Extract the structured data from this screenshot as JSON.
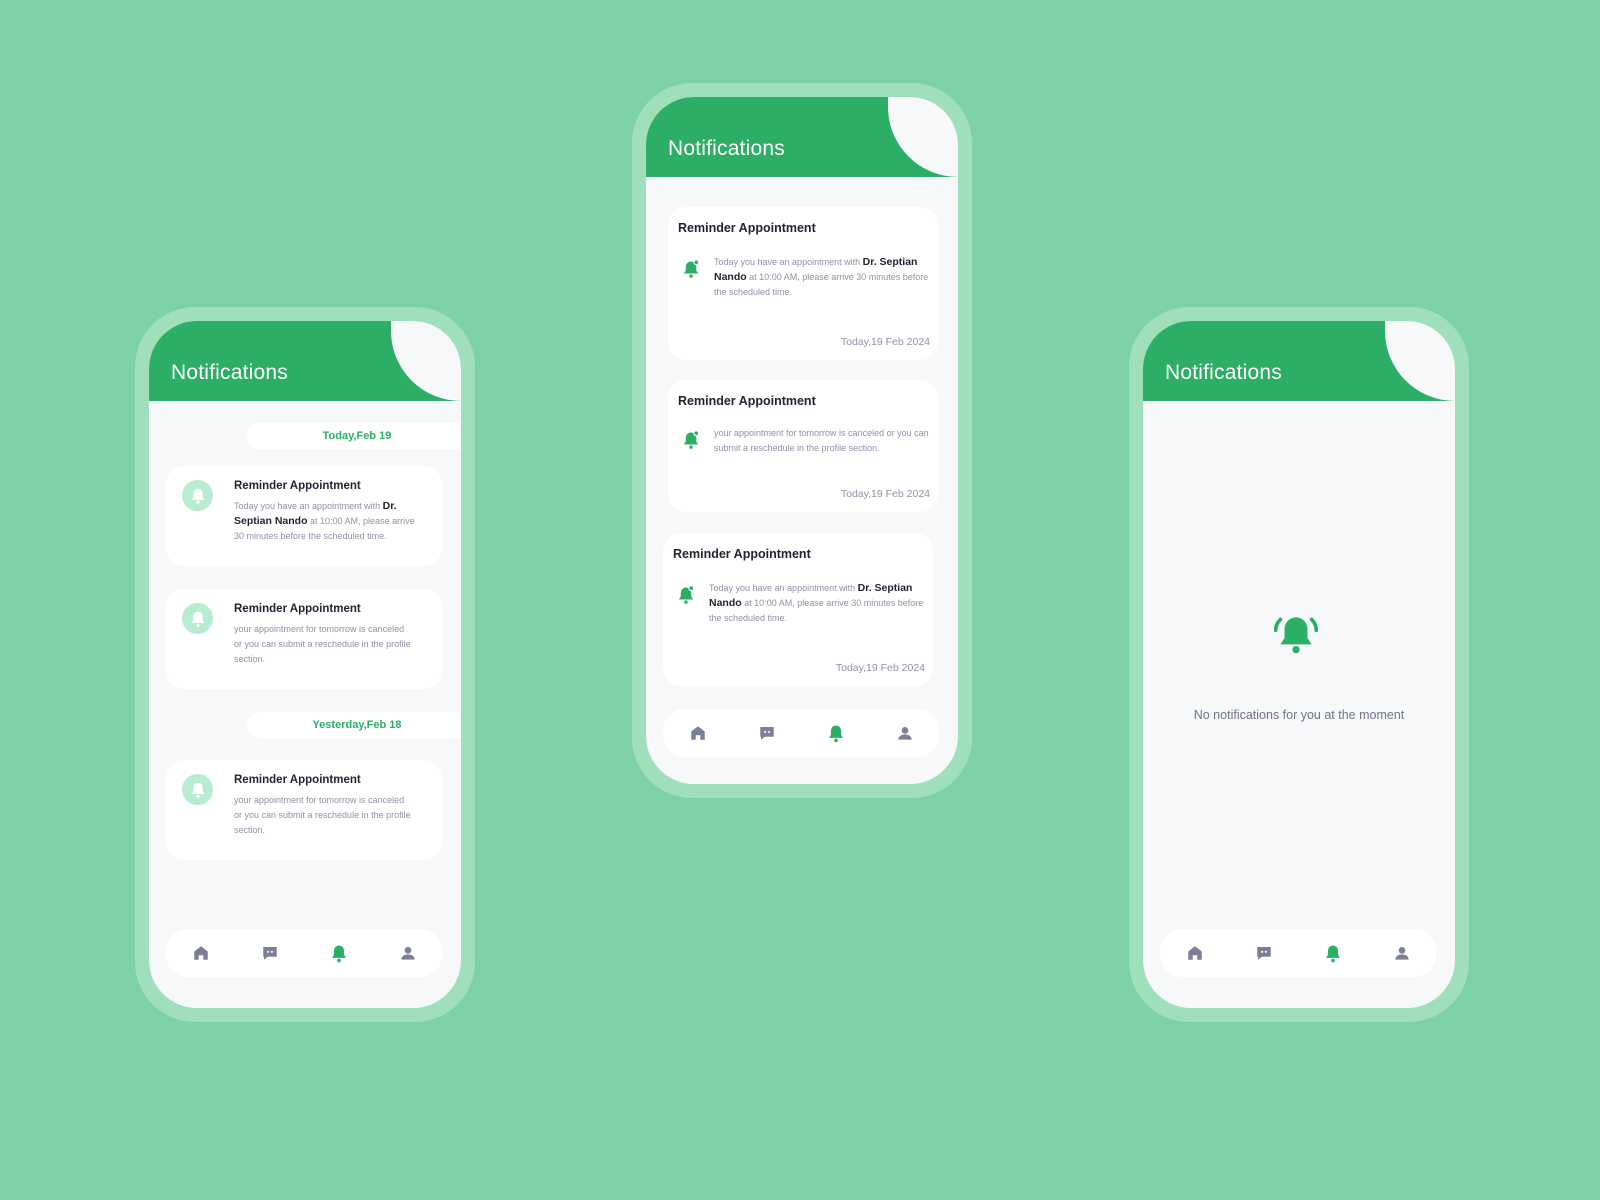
{
  "colors": {
    "background": "#7dd2a3",
    "accent": "#2cae66",
    "text_dark": "#1f2433",
    "text_muted": "#8c92a6"
  },
  "header": {
    "title": "Notifications"
  },
  "nav": {
    "items": [
      {
        "icon": "home-icon"
      },
      {
        "icon": "chat-icon"
      },
      {
        "icon": "bell-icon",
        "active": true
      },
      {
        "icon": "profile-icon"
      }
    ]
  },
  "left_phone": {
    "groups": [
      {
        "date": "Today,Feb 19",
        "items": [
          {
            "title": "Reminder Appointment",
            "body_pre": "Today you have an appointment with ",
            "body_strong": "Dr. Septian Nando",
            "body_post": " at 10:00 AM, please arrive 30 minutes before the scheduled time."
          },
          {
            "title": "Reminder Appointment",
            "body_pre": "your appointment for tomorrow is canceled or you can submit a reschedule in the profile section.",
            "body_strong": "",
            "body_post": ""
          }
        ]
      },
      {
        "date": "Yesterday,Feb 18",
        "items": [
          {
            "title": "Reminder Appointment",
            "body_pre": "your appointment for tomorrow is canceled or you can submit a reschedule in the profile section.",
            "body_strong": "",
            "body_post": ""
          }
        ]
      }
    ]
  },
  "middle_phone": {
    "items": [
      {
        "title": "Reminder Appointment",
        "body_pre": "Today you have an appointment with ",
        "body_strong": "Dr. Septian Nando",
        "body_post": " at 10:00 AM, please arrive 30 minutes before the scheduled time.",
        "time": "Today,19 Feb 2024"
      },
      {
        "title": "Reminder Appointment",
        "body_pre": "your appointment for tomorrow is canceled or you can submit a reschedule in the profile section.",
        "body_strong": "",
        "body_post": "",
        "time": "Today,19 Feb 2024"
      },
      {
        "title": "Reminder Appointment",
        "body_pre": "Today you have an appointment with ",
        "body_strong": "Dr. Septian Nando",
        "body_post": " at 10:00 AM, please arrive 30 minutes before the scheduled time.",
        "time": "Today,19 Feb 2024"
      }
    ]
  },
  "right_phone": {
    "empty_message": "No notifications for you at the moment"
  }
}
